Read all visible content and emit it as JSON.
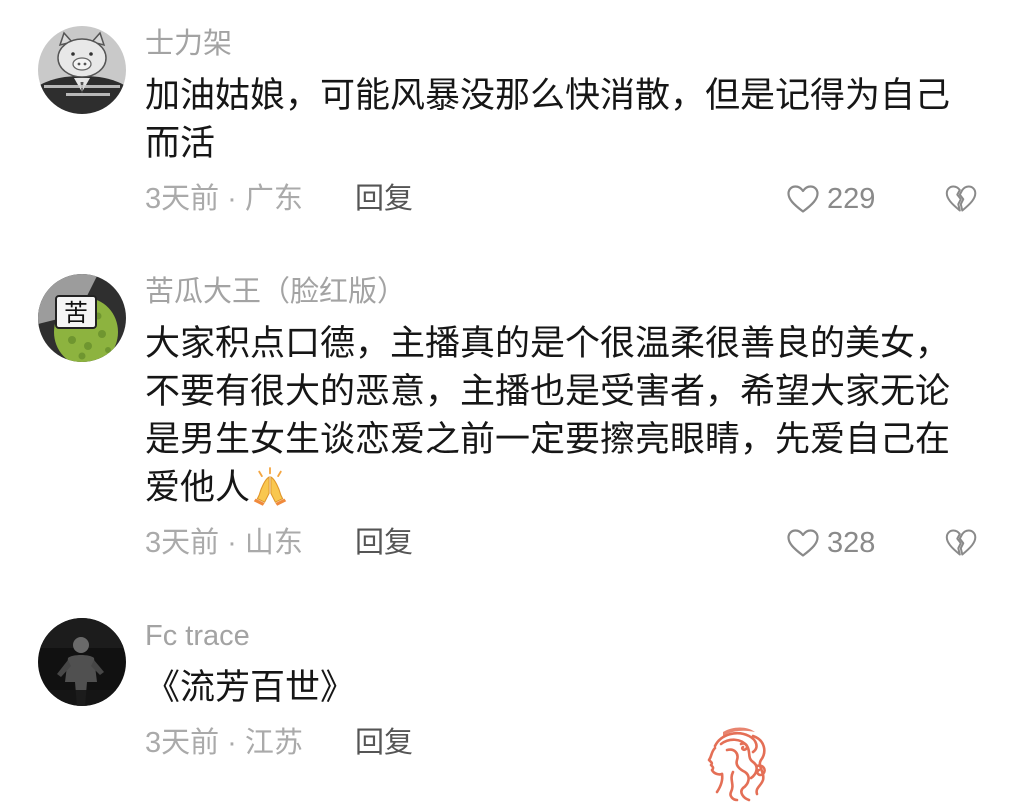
{
  "comments": [
    {
      "username": "士力架",
      "text": "加油姑娘，可能风暴没那么快消散，但是记得为自己而活",
      "time_location": "3天前 · 广东",
      "reply_label": "回复",
      "like_count": "229",
      "avatar": {
        "icon": "pig-cartoon-avatar"
      }
    },
    {
      "username": "苦瓜大王（脸红版）",
      "text": "大家积点口德，主播真的是个很温柔很善良的美女，不要有很大的恶意，主播也是受害者，希望大家无论是男生女生谈恋爱之前一定要擦亮眼睛，先爱自己在爱他人",
      "trailing_emoji": "folded-hands-emoji",
      "time_location": "3天前 · 山东",
      "reply_label": "回复",
      "like_count": "328",
      "avatar": {
        "icon": "bitter-melon-avatar",
        "glyph": "苦"
      }
    },
    {
      "username": "Fc trace",
      "text": "《流芳百世》",
      "time_location": "3天前 · 江苏",
      "reply_label": "回复",
      "avatar": {
        "icon": "dark-portrait-avatar"
      }
    }
  ],
  "icons": {
    "like": "heart-outline-icon",
    "dislike": "broken-heart-icon",
    "watermark": "woman-hair-profile-logo"
  },
  "colors": {
    "text_primary": "#161616",
    "text_secondary": "#a3a3a3",
    "reply_color": "#555555",
    "icon_gray": "#8a8a8a",
    "watermark_coral": "#e46f56",
    "background": "#ffffff"
  }
}
